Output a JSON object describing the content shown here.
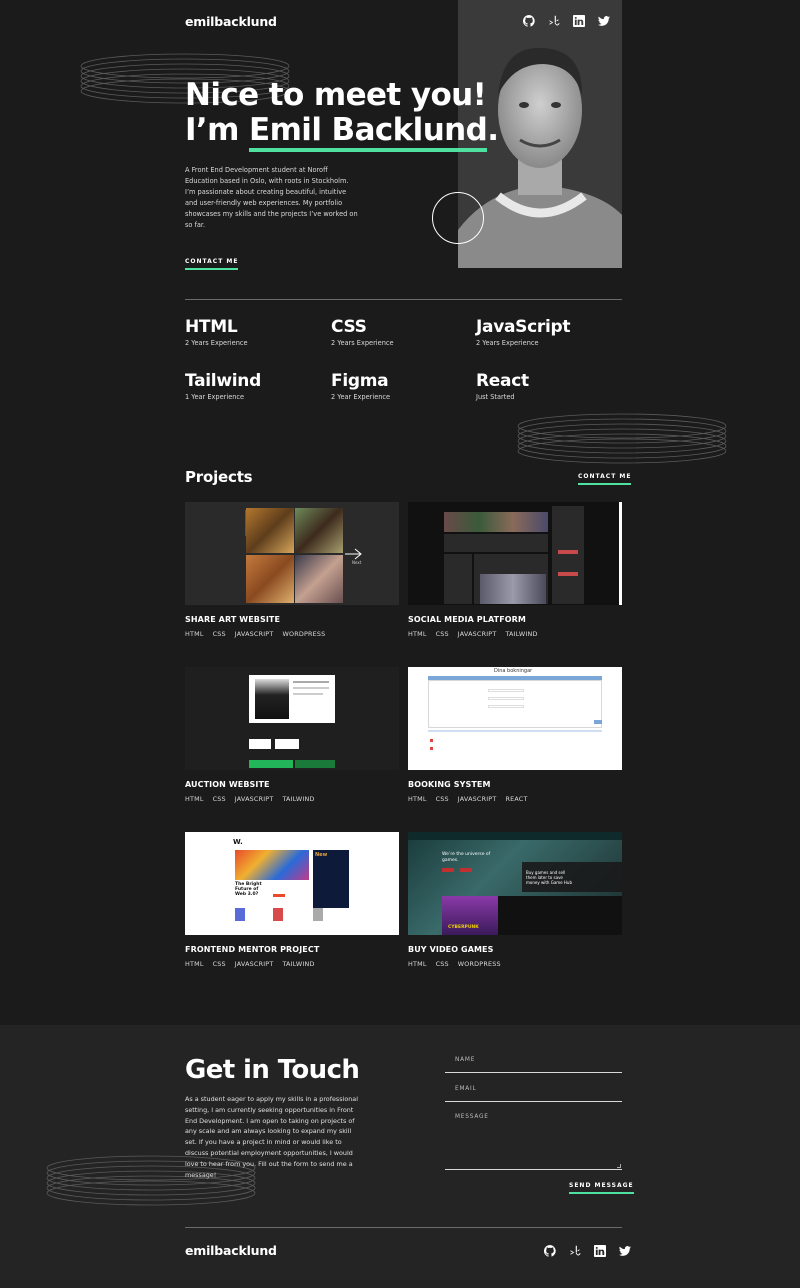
{
  "header": {
    "logo": "emilbacklund",
    "social_icons": [
      "github-icon",
      "frontend-mentor-icon",
      "linkedin-icon",
      "twitter-icon"
    ]
  },
  "hero": {
    "title_line1": "Nice to meet you!",
    "title_prefix": "I’m ",
    "title_name": "Emil Backlund",
    "title_suffix": ".",
    "intro": "A Front End Development student at Noroff Education based in Oslo, with roots in Stockholm. I’m passionate about creating beautiful, intuitive and user-friendly web experiences. My portfolio showcases my skills and the projects I’ve worked on so far.",
    "cta": "CONTACT ME"
  },
  "skills": [
    {
      "name": "HTML",
      "years": "2 Years Experience"
    },
    {
      "name": "CSS",
      "years": "2 Years Experience"
    },
    {
      "name": "JavaScript",
      "years": "2 Years Experience"
    },
    {
      "name": "Tailwind",
      "years": "1 Year Experience"
    },
    {
      "name": "Figma",
      "years": "2 Year Experience"
    },
    {
      "name": "React",
      "years": "Just Started"
    }
  ],
  "projects": {
    "heading": "Projects",
    "cta": "CONTACT ME",
    "items": [
      {
        "title": "SHARE ART WEBSITE",
        "tags": [
          "HTML",
          "CSS",
          "JAVASCRIPT",
          "WORDPRESS"
        ]
      },
      {
        "title": "SOCIAL MEDIA PLATFORM",
        "tags": [
          "HTML",
          "CSS",
          "JAVASCRIPT",
          "TAILWIND"
        ]
      },
      {
        "title": "AUCTION WEBSITE",
        "tags": [
          "HTML",
          "CSS",
          "JAVASCRIPT",
          "TAILWIND"
        ]
      },
      {
        "title": "BOOKING SYSTEM",
        "tags": [
          "HTML",
          "CSS",
          "JAVASCRIPT",
          "REACT"
        ]
      },
      {
        "title": "FRONTEND MENTOR PROJECT",
        "tags": [
          "HTML",
          "CSS",
          "JAVASCRIPT",
          "TAILWIND"
        ]
      },
      {
        "title": "BUY VIDEO GAMES",
        "tags": [
          "HTML",
          "CSS",
          "WORDPRESS"
        ]
      }
    ]
  },
  "thumbs": {
    "art_next": "Next",
    "booking_heading": "Dina bokningar",
    "news_title": "The Bright Future of Web 3.0?",
    "news_new": "New",
    "game_headline": "We’re the universe of games.",
    "game_banner": "Buy games and sell them later to save money with Game Hub",
    "game_poster": "CYBERPUNK"
  },
  "contact": {
    "title": "Get in Touch",
    "text": "As a student eager to apply my skills in a professional setting, I am currently seeking opportunities in Front End Development. I am open to taking on projects of any scale and am always looking to expand my skill set. If you have a project in mind or would like to discuss potential employment opportunities, I would love to hear from you. Fill out the form to send me a message!",
    "name_label": "NAME",
    "email_label": "EMAIL",
    "message_label": "MESSAGE",
    "send": "SEND MESSAGE"
  },
  "footer": {
    "logo": "emilbacklund"
  },
  "colors": {
    "accent": "#4ee1a0",
    "background": "#1b1b1b",
    "contact_background": "#242424"
  }
}
